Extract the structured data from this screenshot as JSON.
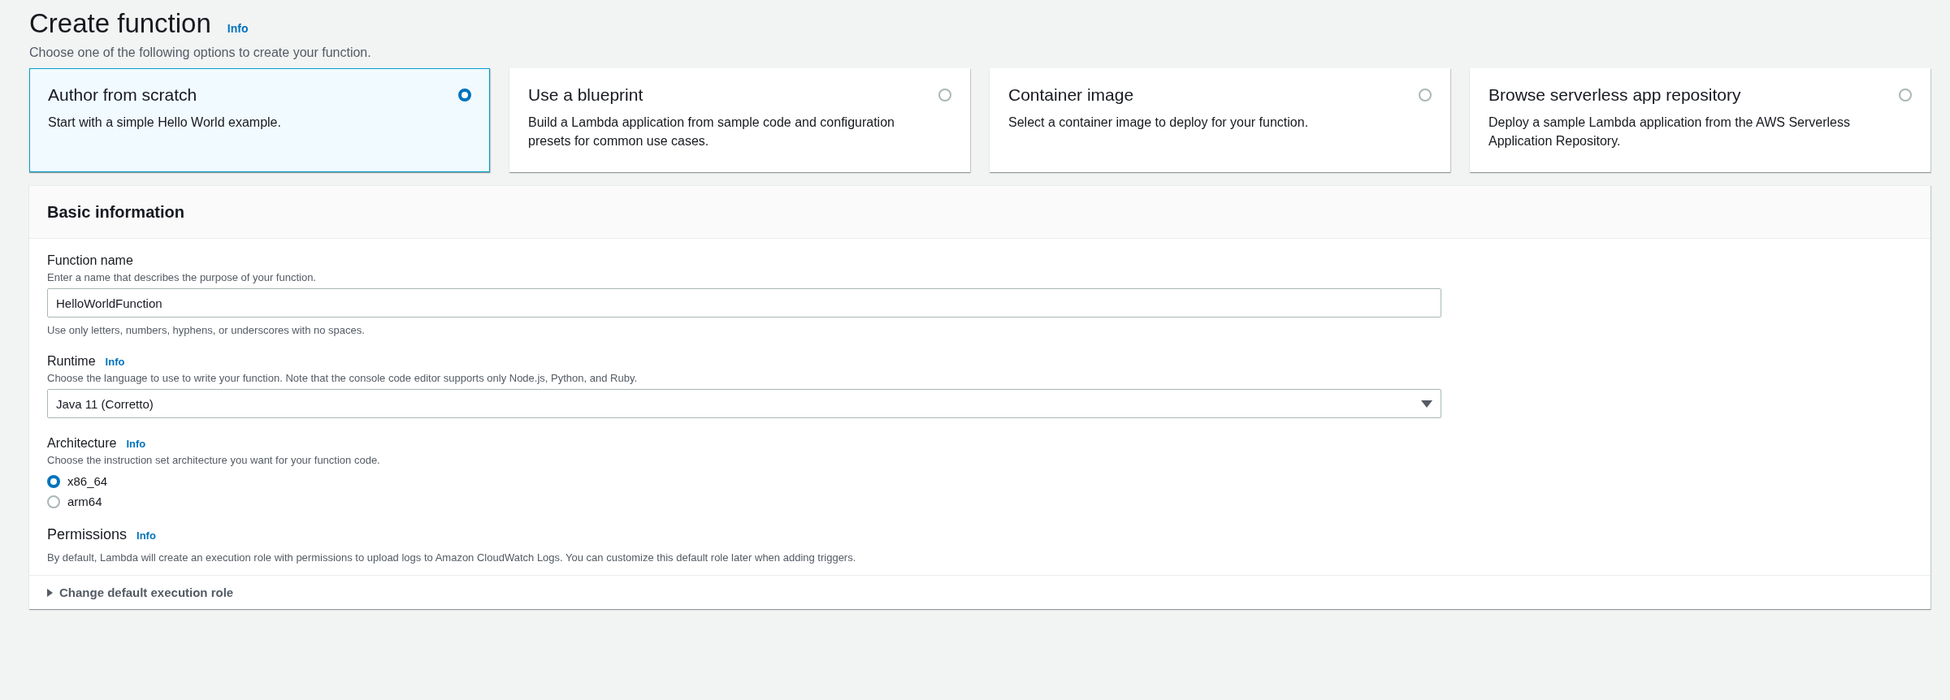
{
  "header": {
    "title": "Create function",
    "info": "Info",
    "description": "Choose one of the following options to create your function."
  },
  "options": [
    {
      "title": "Author from scratch",
      "description": "Start with a simple Hello World example.",
      "selected": true
    },
    {
      "title": "Use a blueprint",
      "description": "Build a Lambda application from sample code and configuration presets for common use cases.",
      "selected": false
    },
    {
      "title": "Container image",
      "description": "Select a container image to deploy for your function.",
      "selected": false
    },
    {
      "title": "Browse serverless app repository",
      "description": "Deploy a sample Lambda application from the AWS Serverless Application Repository.",
      "selected": false
    }
  ],
  "basic_information": {
    "title": "Basic information",
    "fields": [
      {
        "kind": "text",
        "label": "Function name",
        "description": "Enter a name that describes the purpose of your function.",
        "value": "HelloWorldFunction",
        "constraint": "Use only letters, numbers, hyphens, or underscores with no spaces."
      },
      {
        "kind": "select",
        "label": "Runtime",
        "info": "Info",
        "description": "Choose the language to use to write your function. Note that the console code editor supports only Node.js, Python, and Ruby.",
        "value": "Java 11 (Corretto)"
      },
      {
        "kind": "radio",
        "label": "Architecture",
        "info": "Info",
        "description": "Choose the instruction set architecture you want for your function code.",
        "options": [
          {
            "label": "x86_64",
            "selected": true
          },
          {
            "label": "arm64",
            "selected": false
          }
        ]
      }
    ],
    "permissions": {
      "title": "Permissions",
      "info": "Info",
      "description": "By default, Lambda will create an execution role with permissions to upload logs to Amazon CloudWatch Logs. You can customize this default role later when adding triggers.",
      "expander": {
        "label": "Change default execution role",
        "expanded": false
      }
    }
  }
}
